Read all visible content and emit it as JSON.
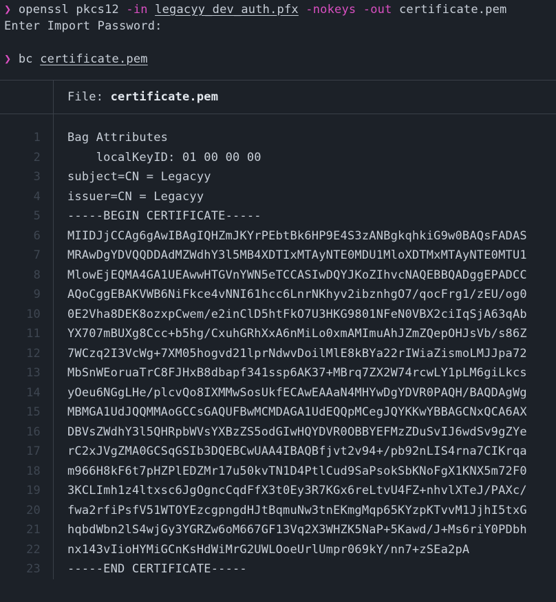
{
  "commands": {
    "prompt_symbol": "❯",
    "line1": {
      "cmd": "openssl",
      "sub": "pkcs12",
      "flag1": "-in",
      "arg1": "legacyy_dev_auth.pfx",
      "flag2": "-nokeys",
      "flag3": "-out",
      "arg2": "certificate.pem"
    },
    "line2_output": "Enter Import Password:",
    "line3": {
      "cmd": "bc",
      "arg": "certificate.pem"
    }
  },
  "viewer": {
    "file_label": "File: ",
    "file_name": "certificate.pem",
    "lines": [
      "Bag Attributes",
      "    localKeyID: 01 00 00 00 ",
      "subject=CN = Legacyy",
      "issuer=CN = Legacyy",
      "-----BEGIN CERTIFICATE-----",
      "MIIDJjCCAg6gAwIBAgIQHZmJKYrPEbtBk6HP9E4S3zANBgkqhkiG9w0BAQsFADAS",
      "MRAwDgYDVQQDDAdMZWdhY3l5MB4XDTIxMTAyNTE0MDU1MloXDTMxMTAyNTE0MTU1",
      "MlowEjEQMA4GA1UEAwwHTGVnYWN5eTCCASIwDQYJKoZIhvcNAQEBBQADggEPADCC",
      "AQoCggEBAKVWB6NiFkce4vNNI61hcc6LnrNKhyv2ibznhgO7/qocFrg1/zEU/og0",
      "0E2Vha8DEK8ozxpCwem/e2inClD5htFkO7U3HKG9801NFeN0VBX2ciIqSjA63qAb",
      "YX707mBUXg8Ccc+b5hg/CxuhGRhXxA6nMiLo0xmAMImuAhJZmZQepOHJsVb/s86Z",
      "7WCzq2I3VcWg+7XM05hogvd21lprNdwvDoilMlE8kBYa22rIWiaZismoLMJJpa72",
      "MbSnWEoruaTrC8FJHxB8dbapf341ssp6AK37+MBrq7ZX2W74rcwLY1pLM6giLkcs",
      "yOeu6NGgLHe/plcvQo8IXMMwSosUkfECAwEAAaN4MHYwDgYDVR0PAQH/BAQDAgWg",
      "MBMGA1UdJQQMMAoGCCsGAQUFBwMCMDAGA1UdEQQpMCegJQYKKwYBBAGCNxQCA6AX",
      "DBVsZWdhY3l5QHRpbWVsYXBzZS5odGIwHQYDVR0OBBYEFMzZDuSvIJ6wdSv9gZYe",
      "rC2xJVgZMA0GCSqGSIb3DQEBCwUAA4IBAQBfjvt2v94+/pb92nLIS4rna7CIKrqa",
      "m966H8kF6t7pHZPlEDZMr17u50kvTN1D4PtlCud9SaPsokSbKNoFgX1KNX5m72F0",
      "3KCLImh1z4ltxsc6JgOgncCqdFfX3t0Ey3R7KGx6reLtvU4FZ+nhvlXTeJ/PAXc/",
      "fwa2rfiPsfV51WTOYEzcgpngdHJtBqmuNw3tnEKmgMqp65KYzpKTvvM1JjhI5txG",
      "hqbdWbn2lS4wjGy3YGRZw6oM667GF13Vq2X3WHZK5NaP+5Kawd/J+Ms6riY0PDbh",
      "nx143vIioHYMiGCnKsHdWiMrG2UWLOoeUrlUmpr069kY/nn7+zSEa2pA",
      "-----END CERTIFICATE-----"
    ]
  }
}
